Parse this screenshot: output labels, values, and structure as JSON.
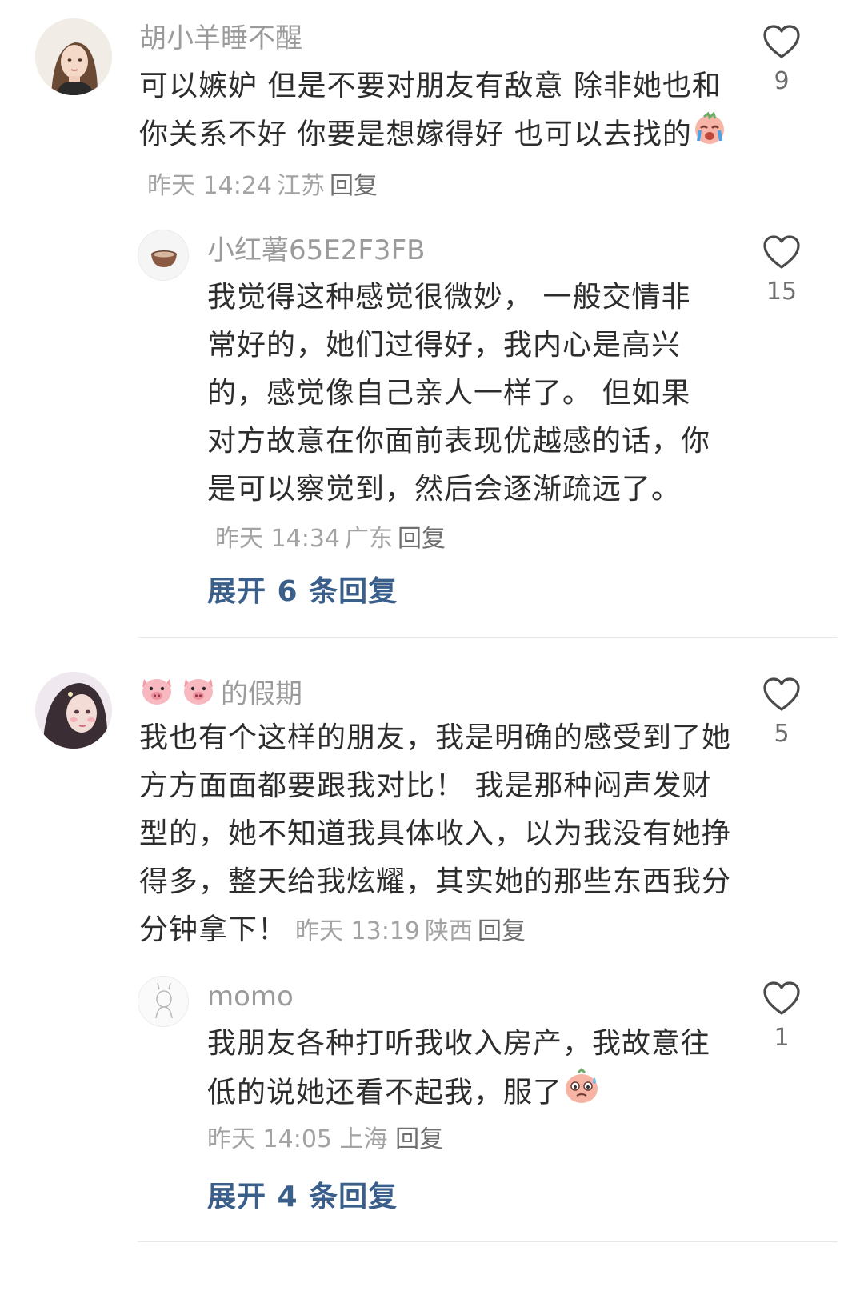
{
  "comments": [
    {
      "username": "胡小羊睡不醒",
      "text": "可以嫉妒 但是不要对朋友有敌意 除非她也和你关系不好 你要是想嫁得好 也可以去找的",
      "emoji_icon": "crying-face-icon",
      "time": "昨天 14:24",
      "location": "江苏",
      "reply_label": "回复",
      "likes": "9",
      "replies": [
        {
          "username": "小红薯65E2F3FB",
          "text": "我觉得这种感觉很微妙， 一般交情非常好的，她们过得好，我内心是高兴的，感觉像自己亲人一样了。 但如果对方故意在你面前表现优越感的话，你是可以察觉到，然后会逐渐疏远了。",
          "time": "昨天 14:34",
          "location": "广东",
          "reply_label": "回复",
          "likes": "15",
          "avatar_icon": "bowl-avatar-icon"
        }
      ],
      "expand_label": "展开 6 条回复"
    },
    {
      "username_emoji": "pig-face-icon",
      "username": "的假期",
      "text": "我也有个这样的朋友，我是明确的感受到了她方方面面都要跟我对比！ 我是那种闷声发财型的，她不知道我具体收入，以为我没有她挣得多，整天给我炫耀，其实她的那些东西我分分钟拿下！",
      "time": "昨天 13:19",
      "location": "陕西",
      "reply_label": "回复",
      "likes": "5",
      "replies": [
        {
          "username": "momo",
          "text": "我朋友各种打听我收入房产，我故意往低的说她还看不起我，服了",
          "emoji_icon": "sweat-face-icon",
          "time": "昨天 14:05",
          "location": "上海",
          "reply_label": "回复",
          "likes": "1",
          "avatar_icon": "sketch-avatar-icon"
        }
      ],
      "expand_label": "展开 4 条回复"
    }
  ]
}
